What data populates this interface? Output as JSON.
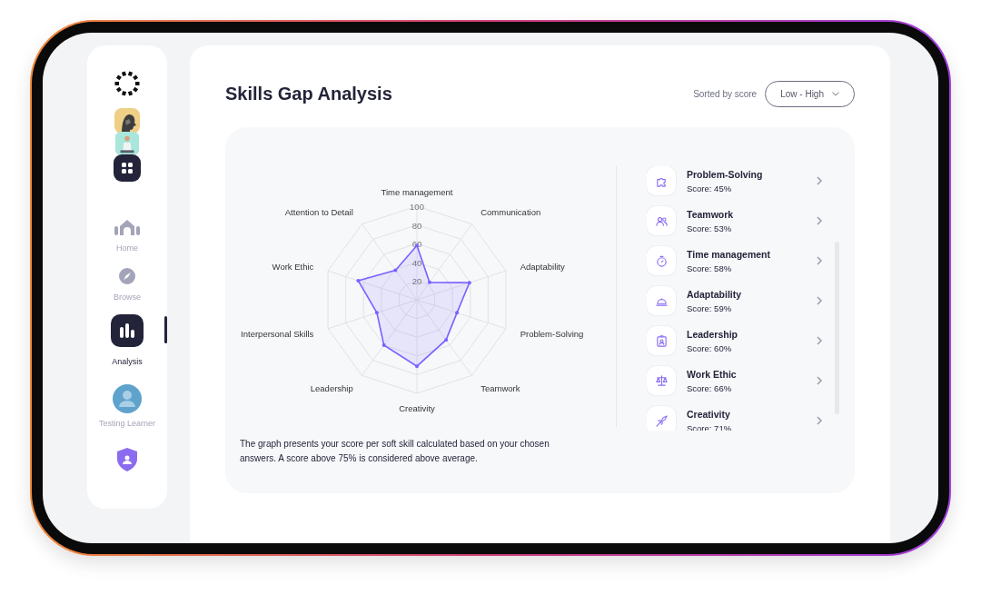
{
  "sidebar": {
    "nav": [
      {
        "label": "Home",
        "selected": false
      },
      {
        "label": "Browse",
        "selected": false
      },
      {
        "label": "Analysis",
        "selected": true
      }
    ],
    "profile": {
      "name": "Testing Learner"
    }
  },
  "header": {
    "title": "Skills Gap Analysis",
    "sort_label": "Sorted by score",
    "sort_value": "Low - High"
  },
  "chart": {
    "chart_data": {
      "type": "radar",
      "categories": [
        "Time management",
        "Communication",
        "Adaptability",
        "Problem-Solving",
        "Teamwork",
        "Creativity",
        "Leadership",
        "Interpersonal Skills",
        "Work Ethic",
        "Attention to Detail"
      ],
      "series": [
        {
          "color": "#7b61ff",
          "values": [
            58,
            23,
            59,
            45,
            53,
            71,
            60,
            45,
            66,
            39
          ]
        }
      ],
      "ylim": [
        0,
        100
      ],
      "yticks": [
        20,
        40,
        60,
        80,
        100
      ]
    },
    "caption": "The graph presents your score per soft skill calculated based on your chosen answers. A score above 75% is considered above average."
  },
  "skills": [
    {
      "name": "Problem-Solving",
      "score": "Score: 45%"
    },
    {
      "name": "Teamwork",
      "score": "Score: 53%"
    },
    {
      "name": "Time management",
      "score": "Score: 58%"
    },
    {
      "name": "Adaptability",
      "score": "Score: 59%"
    },
    {
      "name": "Leadership",
      "score": "Score: 60%"
    },
    {
      "name": "Work Ethic",
      "score": "Score: 66%"
    },
    {
      "name": "Creativity",
      "score": "Score: 71%"
    }
  ]
}
